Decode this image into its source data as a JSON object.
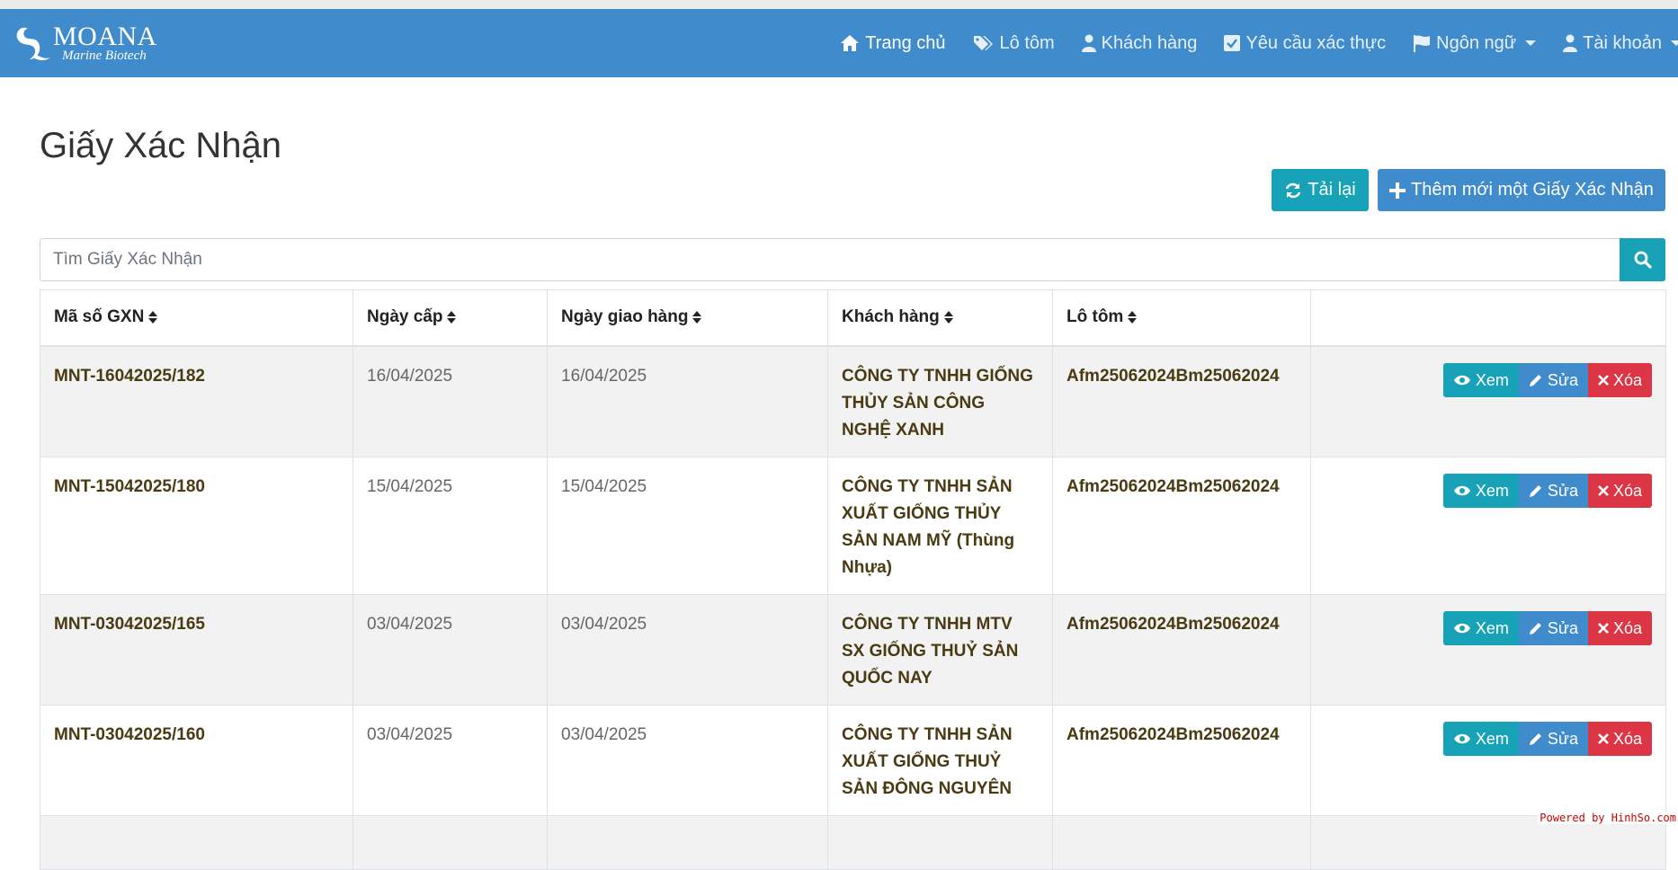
{
  "brand": {
    "name": "MOANA",
    "subtitle": "Marine Biotech"
  },
  "nav": {
    "home": "Trang chủ",
    "lots": "Lô tôm",
    "customers": "Khách hàng",
    "requests": "Yêu cầu xác thực",
    "language": "Ngôn ngữ",
    "account": "Tài khoản"
  },
  "page": {
    "title": "Giấy Xác Nhận"
  },
  "toolbar": {
    "reload_label": "Tải lại",
    "add_label": "Thêm mới một Giấy Xác Nhận"
  },
  "search": {
    "placeholder": "Tìm Giấy Xác Nhận"
  },
  "table": {
    "columns": [
      "Mã số GXN",
      "Ngày cấp",
      "Ngày giao hàng",
      "Khách hàng",
      "Lô tôm"
    ],
    "rows": [
      {
        "code": "MNT-16042025/182",
        "issued": "16/04/2025",
        "delivery": "16/04/2025",
        "customer": "CÔNG TY TNHH GIỐNG THỦY SẢN CÔNG NGHỆ XANH",
        "lot": "Afm25062024Bm25062024"
      },
      {
        "code": "MNT-15042025/180",
        "issued": "15/04/2025",
        "delivery": "15/04/2025",
        "customer": "CÔNG TY TNHH SẢN XUẤT GIỐNG THỦY SẢN NAM MỸ (Thùng Nhựa)",
        "lot": "Afm25062024Bm25062024"
      },
      {
        "code": "MNT-03042025/165",
        "issued": "03/04/2025",
        "delivery": "03/04/2025",
        "customer": "CÔNG TY TNHH MTV SX GIỐNG THUỶ SẢN QUỐC NAY",
        "lot": "Afm25062024Bm25062024"
      },
      {
        "code": "MNT-03042025/160",
        "issued": "03/04/2025",
        "delivery": "03/04/2025",
        "customer": "CÔNG TY TNHH SẢN XUẤT GIỐNG THUỶ SẢN ĐÔNG NGUYÊN",
        "lot": "Afm25062024Bm25062024"
      }
    ],
    "actions": {
      "view": "Xem",
      "edit": "Sửa",
      "delete": "Xóa"
    }
  },
  "footer": {
    "powered": "Powered by HinhSo.com"
  }
}
